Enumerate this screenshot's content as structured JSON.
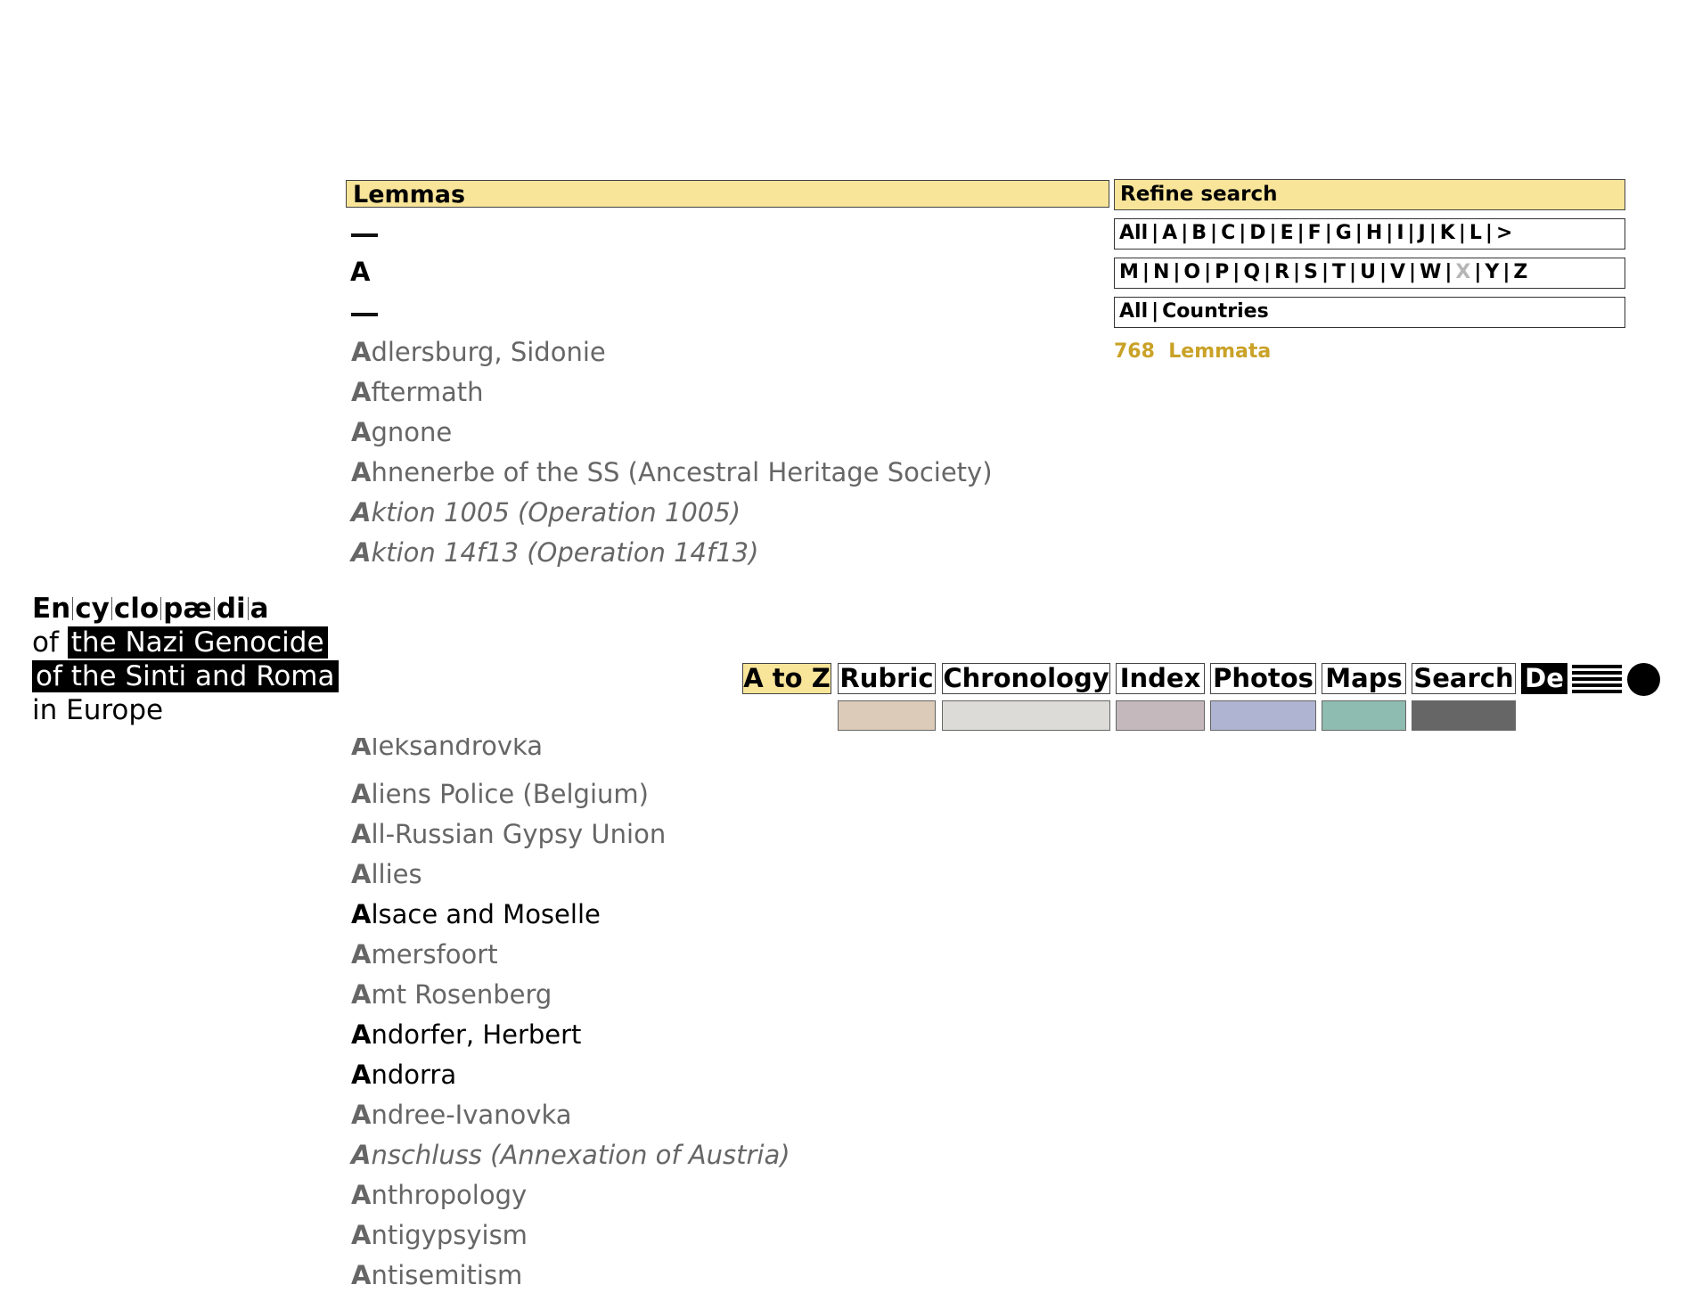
{
  "list": {
    "header": "Lemmas",
    "letter": "A",
    "entries_top": [
      {
        "ini": "A",
        "rest": "dlersburg, Sidonie",
        "style": "grey"
      },
      {
        "ini": "A",
        "rest": "ftermath",
        "style": "grey"
      },
      {
        "ini": "A",
        "rest": "gnone",
        "style": "grey"
      },
      {
        "ini": "A",
        "rest": "hnenerbe of the SS (Ancestral Heritage Society)",
        "style": "grey"
      },
      {
        "ini": "A",
        "rest": "ktion 1005 (Operation 1005)",
        "style": "italic"
      },
      {
        "ini": "A",
        "rest": "ktion 14f13 (Operation 14f13)",
        "style": "italic"
      }
    ],
    "entry_partial": {
      "ini": "A",
      "rest": "leksandrovka"
    },
    "entries_bottom": [
      {
        "ini": "A",
        "rest": "liens Police (Belgium)",
        "style": "grey"
      },
      {
        "ini": "A",
        "rest": "ll-Russian Gypsy Union",
        "style": "grey"
      },
      {
        "ini": "A",
        "rest": "llies",
        "style": "grey"
      },
      {
        "ini": "A",
        "rest": "lsace and Moselle",
        "style": "black"
      },
      {
        "ini": "A",
        "rest": "mersfoort",
        "style": "grey"
      },
      {
        "ini": "A",
        "rest": "mt Rosenberg",
        "style": "grey"
      },
      {
        "ini": "A",
        "rest": "ndorfer, Herbert",
        "style": "black"
      },
      {
        "ini": "A",
        "rest": "ndorra",
        "style": "black"
      },
      {
        "ini": "A",
        "rest": "ndree-Ivanovka",
        "style": "grey"
      },
      {
        "ini": "A",
        "rest": "nschluss (Annexation of Austria)",
        "style": "italic"
      },
      {
        "ini": "A",
        "rest": "nthropology",
        "style": "grey"
      },
      {
        "ini": "A",
        "rest": "ntigypsyism",
        "style": "grey"
      },
      {
        "ini": "A",
        "rest": "ntisemitism",
        "style": "grey"
      }
    ]
  },
  "refine": {
    "header": "Refine search",
    "row1": [
      "All",
      "A",
      "B",
      "C",
      "D",
      "E",
      "F",
      "G",
      "H",
      "I",
      "J",
      "K",
      "L",
      ">"
    ],
    "row2": [
      "M",
      "N",
      "O",
      "P",
      "Q",
      "R",
      "S",
      "T",
      "U",
      "V",
      "W",
      "X",
      "Y",
      "Z"
    ],
    "row2_disabled": [
      "X"
    ],
    "row3": [
      "All",
      "Countries"
    ],
    "count": "768",
    "count_label": "Lemmata"
  },
  "logo": {
    "title_parts": [
      "En",
      "cy",
      "clo",
      "pæ",
      "di",
      "a"
    ],
    "of": "of",
    "line2": "the Nazi Genocide",
    "line3": "of the Sinti and Roma",
    "line4": "in Europe"
  },
  "nav": {
    "a_to_z": "A to Z",
    "rubric": "Rubric",
    "chronology": "Chronology",
    "index": "Index",
    "photos": "Photos",
    "maps": "Maps",
    "search": "Search",
    "lang": "De"
  },
  "colors": {
    "accent_yellow": "#f8e59a",
    "count_gold": "#c9a227",
    "swatch_rubric": "#dccbb8",
    "swatch_chronology": "#dcdbd8",
    "swatch_index": "#c5b8bd",
    "swatch_photos": "#afb4d2",
    "swatch_maps": "#8fbcb0",
    "swatch_search": "#666666"
  }
}
